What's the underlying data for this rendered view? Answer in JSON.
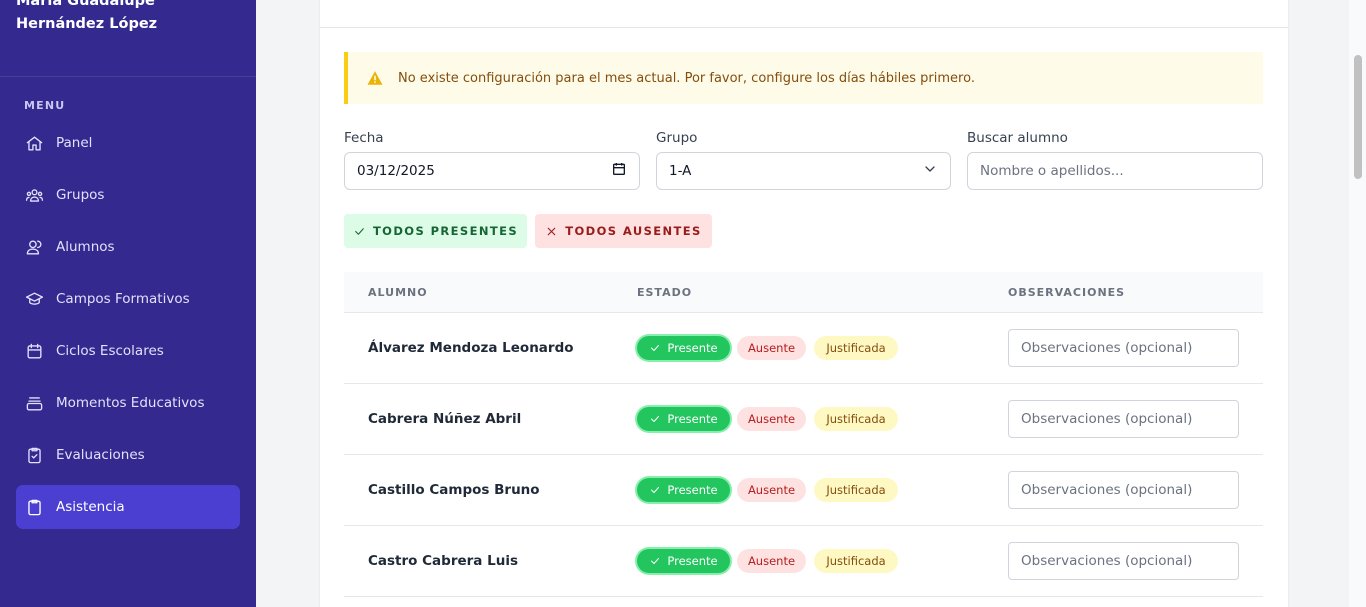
{
  "sidebar": {
    "user_name": "María Guadalupe Hernández López",
    "menu_heading": "MENU",
    "items": [
      {
        "label": "Panel",
        "icon": "home-icon"
      },
      {
        "label": "Grupos",
        "icon": "users-group-icon"
      },
      {
        "label": "Alumnos",
        "icon": "users-icon"
      },
      {
        "label": "Campos Formativos",
        "icon": "graduation-cap-icon"
      },
      {
        "label": "Ciclos Escolares",
        "icon": "calendar-icon"
      },
      {
        "label": "Momentos Educativos",
        "icon": "layers-icon"
      },
      {
        "label": "Evaluaciones",
        "icon": "clipboard-check-icon"
      },
      {
        "label": "Asistencia",
        "icon": "clipboard-icon",
        "active": true
      }
    ]
  },
  "alert": {
    "text": "No existe configuración para el mes actual. Por favor, configure los días hábiles primero.",
    "icon": "warning-icon"
  },
  "filters": {
    "fecha_label": "Fecha",
    "fecha_value": "03/12/2025",
    "grupo_label": "Grupo",
    "grupo_value": "1-A",
    "buscar_label": "Buscar alumno",
    "buscar_placeholder": "Nombre o apellidos..."
  },
  "actions": {
    "all_present": "TODOS PRESENTES",
    "all_absent": "TODOS AUSENTES"
  },
  "table": {
    "headers": {
      "alumno": "ALUMNO",
      "estado": "ESTADO",
      "observaciones": "OBSERVACIONES"
    },
    "status_labels": {
      "present": "Presente",
      "absent": "Ausente",
      "justified": "Justificada"
    },
    "obs_placeholder": "Observaciones (opcional)",
    "rows": [
      {
        "name": "Álvarez Mendoza Leonardo",
        "status": "Presente"
      },
      {
        "name": "Cabrera Núñez Abril",
        "status": "Presente"
      },
      {
        "name": "Castillo Campos Bruno",
        "status": "Presente"
      },
      {
        "name": "Castro Cabrera Luis",
        "status": "Presente"
      }
    ]
  },
  "colors": {
    "sidebar_bg": "#33298f",
    "active_item": "#4b3fd1",
    "present": "#22c55e",
    "absent_bg": "#fee2e2",
    "justified_bg": "#fef9c3",
    "alert_border": "#facc15"
  }
}
